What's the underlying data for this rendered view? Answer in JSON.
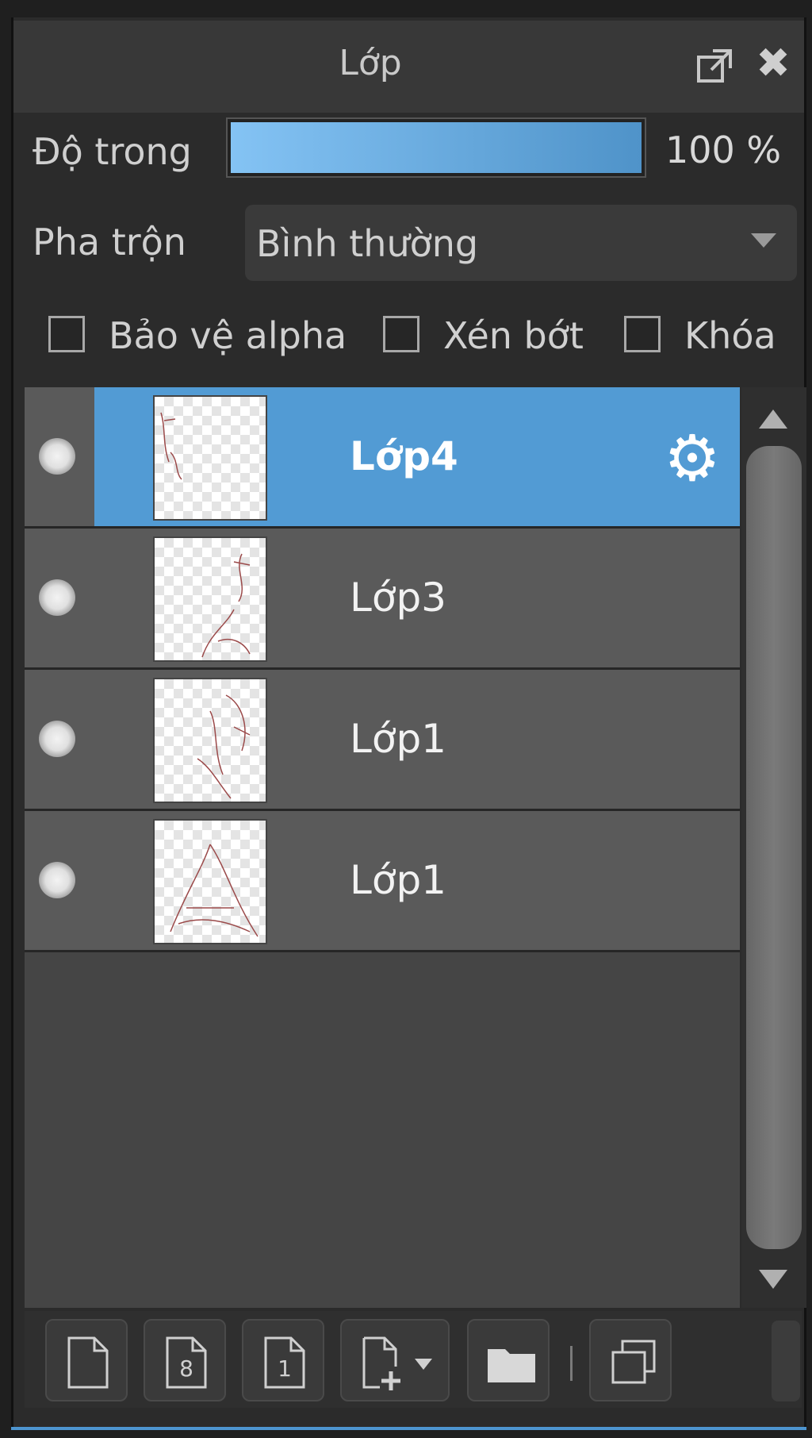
{
  "panel": {
    "title": "Lớp"
  },
  "opacity": {
    "label": "Độ trong",
    "value_text": "100 %",
    "fraction": 1.0
  },
  "blend": {
    "label": "Pha trộn",
    "selected": "Bình thường"
  },
  "checkboxes": [
    {
      "label": "Bảo vệ alpha",
      "checked": false
    },
    {
      "label": "Xén bớt",
      "checked": false
    },
    {
      "label": "Khóa",
      "checked": false
    }
  ],
  "layers": [
    {
      "name": "Lớp4",
      "selected": true,
      "visible": true
    },
    {
      "name": "Lớp3",
      "selected": false,
      "visible": true
    },
    {
      "name": "Lớp1",
      "selected": false,
      "visible": true
    },
    {
      "name": "Lớp1",
      "selected": false,
      "visible": true
    }
  ],
  "icons": {
    "popout": "popout-icon",
    "close": "close-icon",
    "settings": "gear-icon",
    "new_layer": "new-layer-icon",
    "new_8bit_layer": "new-8bit-layer-icon",
    "new_1bit_layer": "new-1bit-layer-icon",
    "add_layer_menu": "add-layer-menu-icon",
    "folder": "folder-icon",
    "duplicate": "duplicate-layer-icon"
  },
  "colors": {
    "accent": "#529bd4",
    "opacity_fill_start": "#84c3f4",
    "opacity_fill_end": "#4f93c9"
  }
}
